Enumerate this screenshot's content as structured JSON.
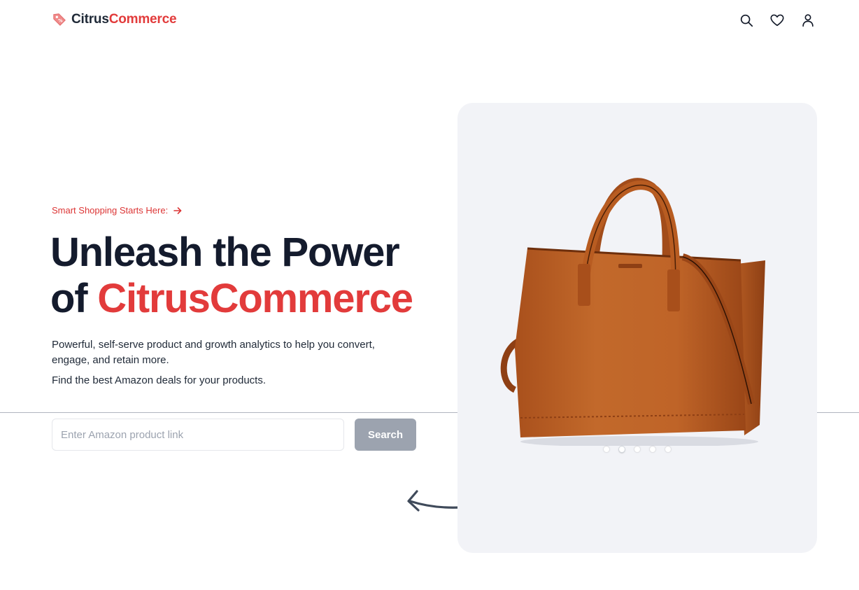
{
  "brand": {
    "name_part1": "Citrus",
    "name_part2": "Commerce",
    "accent_color": "#e23b3b"
  },
  "header": {
    "icons": [
      "search-icon",
      "heart-icon",
      "user-icon"
    ]
  },
  "hero": {
    "eyebrow": "Smart Shopping Starts Here:",
    "headline_line1": "Unleash the Power",
    "headline_of": "of ",
    "headline_accent": "CitrusCommerce",
    "description": "Powerful, self-serve product and growth analytics to help you convert, engage, and retain more.",
    "description2": "Find the best Amazon deals for your products."
  },
  "search": {
    "placeholder": "Enter Amazon product link",
    "value": "",
    "button_label": "Search"
  },
  "carousel": {
    "slides": 5,
    "active_index": 1,
    "image": "brown-leather-tote-bag"
  }
}
